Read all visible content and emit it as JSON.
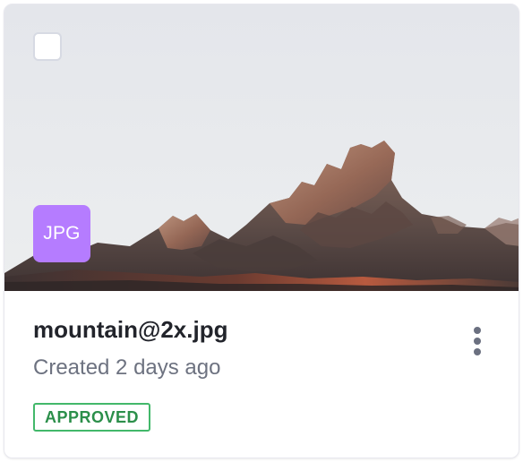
{
  "card": {
    "file_type": "JPG",
    "file_name": "mountain@2x.jpg",
    "created": "Created 2 days ago",
    "status": "APPROVED",
    "colors": {
      "badge_bg": "#b57cff",
      "status_border": "#42b86a",
      "status_text": "#2b8f4a"
    },
    "icons": {
      "checkbox": "checkbox-unchecked",
      "more": "more-vertical-icon"
    }
  }
}
